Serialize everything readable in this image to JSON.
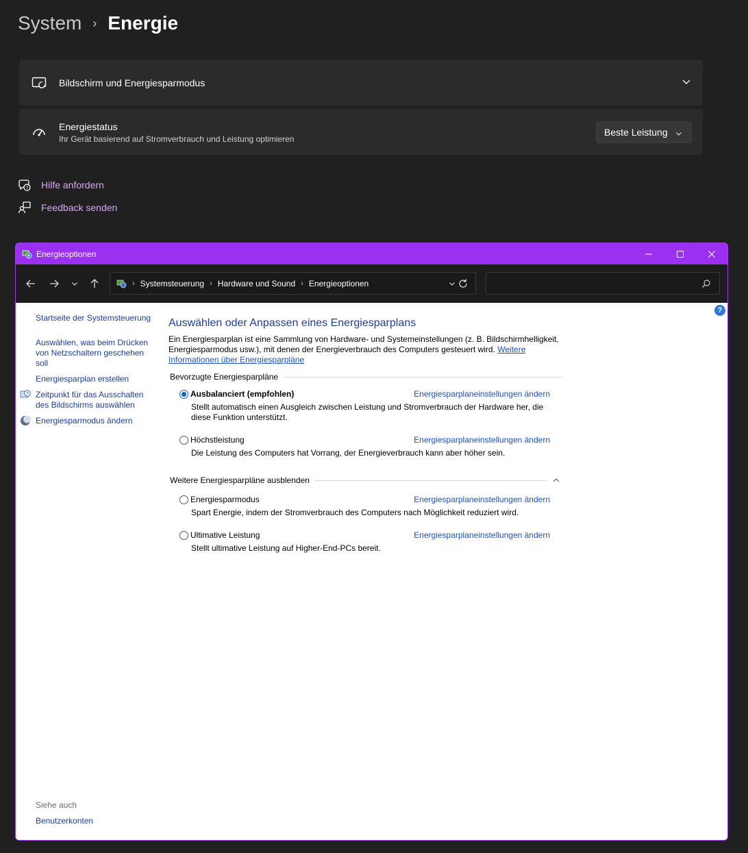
{
  "settings": {
    "breadcrumb_parent": "System",
    "breadcrumb_current": "Energie",
    "display_card_title": "Bildschirm und Energiesparmodus",
    "power_mode_title": "Energiestatus",
    "power_mode_sub": "Ihr Gerät basierend auf Stromverbrauch und Leistung optimieren",
    "power_mode_value": "Beste Leistung",
    "help_link": "Hilfe anfordern",
    "feedback_link": "Feedback senden"
  },
  "window": {
    "title": "Energieoptionen",
    "address": [
      "Systemsteuerung",
      "Hardware und Sound",
      "Energieoptionen"
    ],
    "search_placeholder": ""
  },
  "sidebar": {
    "items": [
      "Startseite der Systemsteuerung",
      "Auswählen, was beim Drücken von Netzschaltern geschehen soll",
      "Energiesparplan erstellen",
      "Zeitpunkt für das Ausschalten des Bildschirms auswählen",
      "Energiesparmodus ändern"
    ],
    "see_also": "Siehe auch",
    "user_accounts": "Benutzerkonten"
  },
  "main": {
    "heading": "Auswählen oder Anpassen eines Energiesparplans",
    "intro": "Ein Energiesparplan ist eine Sammlung von Hardware- und Systemeinstellungen (z. B. Bildschirmhelligkeit, Energiesparmodus usw.), mit denen der Energieverbrauch des Computers gesteuert wird.",
    "intro_link": "Weitere Informationen über Energiesparpläne",
    "preferred_group": "Bevorzugte Energiesparpläne",
    "more_group": "Weitere Energiesparpläne ausblenden",
    "change_link": "Energiesparplaneinstellungen ändern",
    "plans": [
      {
        "name": "Ausbalanciert (empfohlen)",
        "desc": "Stellt automatisch einen Ausgleich zwischen Leistung und Stromverbrauch der Hardware her, die diese Funktion unterstützt.",
        "selected": true
      },
      {
        "name": "Höchstleistung",
        "desc": "Die Leistung des Computers hat Vorrang, der Energieverbrauch kann aber höher sein.",
        "selected": false
      },
      {
        "name": "Energiesparmodus",
        "desc": "Spart Energie, indem der Stromverbrauch des Computers nach Möglichkeit reduziert wird.",
        "selected": false
      },
      {
        "name": "Ultimative Leistung",
        "desc": "Stellt ultimative Leistung auf Higher-End-PCs bereit.",
        "selected": false
      }
    ]
  },
  "colors": {
    "titlebar": "#9b30f0",
    "link_accent_dark": "#d9a6f5",
    "link_blue": "#1e50c0"
  }
}
